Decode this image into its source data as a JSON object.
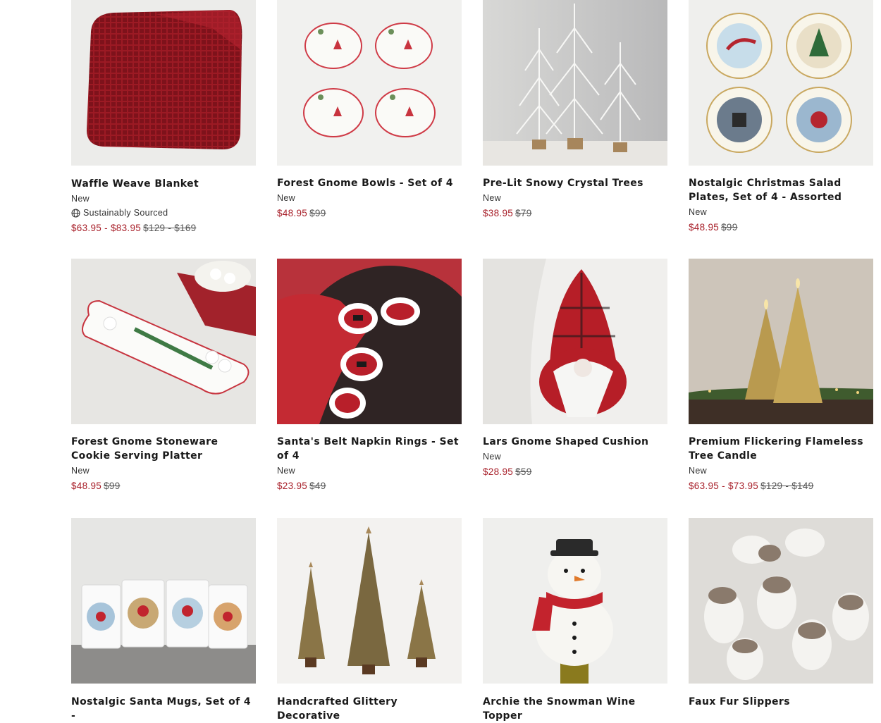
{
  "colors": {
    "sale": "#a8202a",
    "text": "#1a1a1a"
  },
  "products": [
    {
      "title": "Waffle Weave Blanket",
      "badge": "New",
      "eco": "Sustainably Sourced",
      "sale": "$63.95 - $83.95",
      "orig": "$129 - $169"
    },
    {
      "title": "Forest Gnome Bowls - Set of 4",
      "badge": "New",
      "sale": "$48.95",
      "orig": "$99"
    },
    {
      "title": "Pre-Lit Snowy Crystal Trees",
      "badge": "New",
      "sale": "$38.95",
      "orig": "$79"
    },
    {
      "title": "Nostalgic Christmas Salad Plates, Set of 4 - Assorted",
      "badge": "New",
      "sale": "$48.95",
      "orig": "$99"
    },
    {
      "title": "Forest Gnome Stoneware Cookie Serving Platter",
      "badge": "New",
      "sale": "$48.95",
      "orig": "$99"
    },
    {
      "title": "Santa's Belt Napkin Rings - Set of 4",
      "badge": "New",
      "sale": "$23.95",
      "orig": "$49"
    },
    {
      "title": "Lars Gnome Shaped Cushion",
      "badge": "New",
      "sale": "$28.95",
      "orig": "$59"
    },
    {
      "title": "Premium Flickering Flameless Tree Candle",
      "badge": "New",
      "sale": "$63.95 - $73.95",
      "orig": "$129 - $149"
    },
    {
      "title": "Nostalgic Santa Mugs, Set of 4 -"
    },
    {
      "title": "Handcrafted Glittery Decorative"
    },
    {
      "title": "Archie the Snowman Wine Topper"
    },
    {
      "title": "Faux Fur Slippers"
    }
  ]
}
